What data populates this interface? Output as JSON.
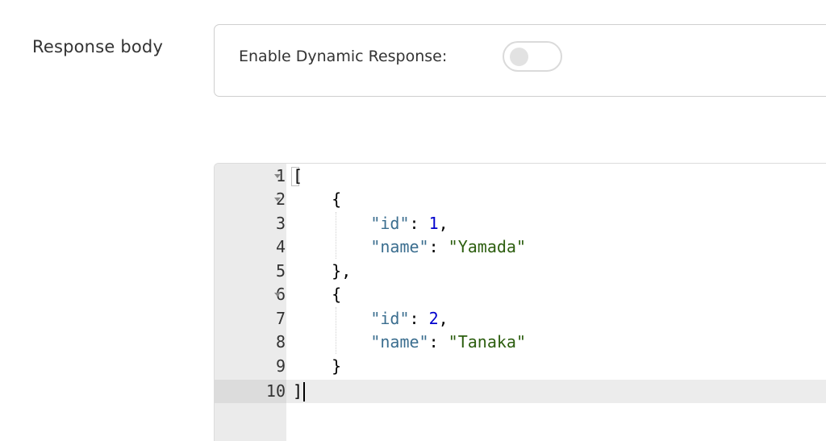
{
  "form": {
    "response_body_label": "Response body",
    "dynamic_response_label": "Enable Dynamic Response:",
    "dynamic_response_enabled": false
  },
  "editor": {
    "line_numbers": [
      "1",
      "2",
      "3",
      "4",
      "5",
      "6",
      "7",
      "8",
      "9",
      "10"
    ],
    "active_line": "10",
    "lines": {
      "l1": {
        "open": "["
      },
      "l2": {
        "text": "{"
      },
      "l3": {
        "key": "\"id\"",
        "sep": ": ",
        "value": "1",
        "end": ","
      },
      "l4": {
        "key": "\"name\"",
        "sep": ": ",
        "value": "\"Yamada\""
      },
      "l5": {
        "text": "},"
      },
      "l6": {
        "text": "{"
      },
      "l7": {
        "key": "\"id\"",
        "sep": ": ",
        "value": "2",
        "end": ","
      },
      "l8": {
        "key": "\"name\"",
        "sep": ": ",
        "value": "\"Tanaka\""
      },
      "l9": {
        "text": "}"
      },
      "l10": {
        "close": "]"
      }
    }
  }
}
